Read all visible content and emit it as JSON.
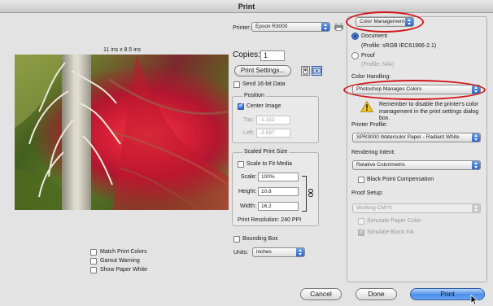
{
  "window": {
    "title": "Print"
  },
  "preview": {
    "size_label": "11 ins x 8.5 ins"
  },
  "printer": {
    "label": "Printer:",
    "value": "Epson R3000"
  },
  "copies": {
    "label": "Copies:",
    "value": "1"
  },
  "print_settings_button": "Print Settings...",
  "send16bit": {
    "label": "Send 16-bit Data",
    "checked": false
  },
  "position": {
    "title": "Position",
    "center_image": {
      "label": "Center Image",
      "checked": true
    },
    "top": {
      "label": "Top:",
      "value": "-1.152"
    },
    "left": {
      "label": "Left:",
      "value": "-2.597"
    }
  },
  "scaled_print_size": {
    "title": "Scaled Print Size",
    "scale_to_fit": {
      "label": "Scale to Fit Media",
      "checked": false
    },
    "scale": {
      "label": "Scale:",
      "value": "100%"
    },
    "height": {
      "label": "Height:",
      "value": "10.8"
    },
    "width": {
      "label": "Width:",
      "value": "16.2"
    },
    "resolution": "Print Resolution: 240 PPI"
  },
  "bounding_box": {
    "label": "Bounding Box",
    "checked": false
  },
  "units": {
    "label": "Units:",
    "value": "inches"
  },
  "preview_options": [
    {
      "label": "Match Print Colors",
      "checked": false
    },
    {
      "label": "Gamut Warning",
      "checked": false
    },
    {
      "label": "Show Paper White",
      "checked": false
    }
  ],
  "color_panel": {
    "mode_select": "Color Management",
    "document": {
      "label": "Document",
      "profile": "(Profile: sRGB IEC61966-2.1)",
      "selected": true
    },
    "proof": {
      "label": "Proof",
      "profile": "(Profile: N/A)",
      "selected": false
    },
    "color_handling": {
      "label": "Color Handling:",
      "value": "Photoshop Manages Colors"
    },
    "warning": "Remember to disable the printer's color management in the print settings dialog box.",
    "printer_profile": {
      "label": "Printer Profile:",
      "value": "SPR3000 Watercolor Paper - Radiant White"
    },
    "rendering_intent": {
      "label": "Rendering Intent:",
      "value": "Relative Colorimetric"
    },
    "black_point": {
      "label": "Black Point Compensation",
      "checked": false
    },
    "proof_setup": {
      "label": "Proof Setup:",
      "value": "Working CMYK"
    },
    "simulate_paper": {
      "label": "Simulate Paper Color",
      "checked": false
    },
    "simulate_black": {
      "label": "Simulate Black Ink",
      "checked": true
    }
  },
  "buttons": {
    "cancel": "Cancel",
    "done": "Done",
    "print": "Print"
  },
  "colors": {
    "highlight": "#d0161a",
    "accent": "#4c8ee8"
  }
}
